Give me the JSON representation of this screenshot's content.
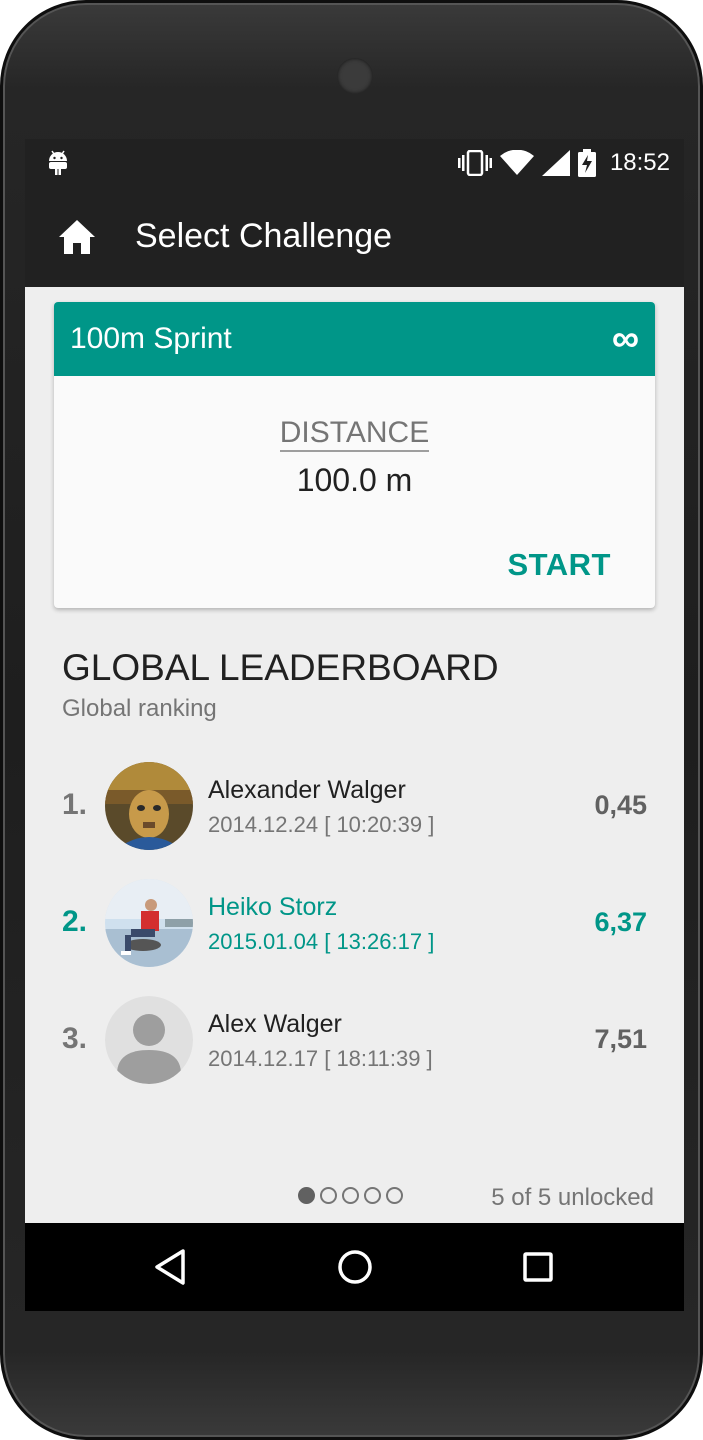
{
  "status_bar": {
    "time": "18:52",
    "icons": [
      "android-icon",
      "vibrate-icon",
      "wifi-icon",
      "signal-icon",
      "battery-charging-icon"
    ]
  },
  "app_bar": {
    "title": "Select Challenge",
    "nav_icon": "home-icon"
  },
  "challenge": {
    "name": "100m Sprint",
    "repeat_icon": "infinity-icon",
    "repeat_symbol": "∞",
    "distance_label": "DISTANCE",
    "distance_value": "100.0 m",
    "start_label": "START"
  },
  "leaderboard": {
    "title": "GLOBAL LEADERBOARD",
    "subtitle": "Global ranking",
    "entries": [
      {
        "rank": "1.",
        "name": "Alexander Walger",
        "date": "2014.12.24 [ 10:20:39 ]",
        "score": "0,45",
        "highlighted": false
      },
      {
        "rank": "2.",
        "name": "Heiko Storz",
        "date": "2015.01.04 [ 13:26:17 ]",
        "score": "6,37",
        "highlighted": true
      },
      {
        "rank": "3.",
        "name": "Alex Walger",
        "date": "2014.12.17 [ 18:11:39 ]",
        "score": "7,51",
        "highlighted": false
      }
    ]
  },
  "pager": {
    "total": 5,
    "current": 1,
    "unlocked_text": "5 of 5 unlocked"
  },
  "nav_bar": {
    "buttons": [
      "back-icon",
      "home-circle-icon",
      "recents-icon"
    ]
  },
  "colors": {
    "accent": "#009688",
    "bar": "#212121",
    "background": "#eeeeee"
  }
}
